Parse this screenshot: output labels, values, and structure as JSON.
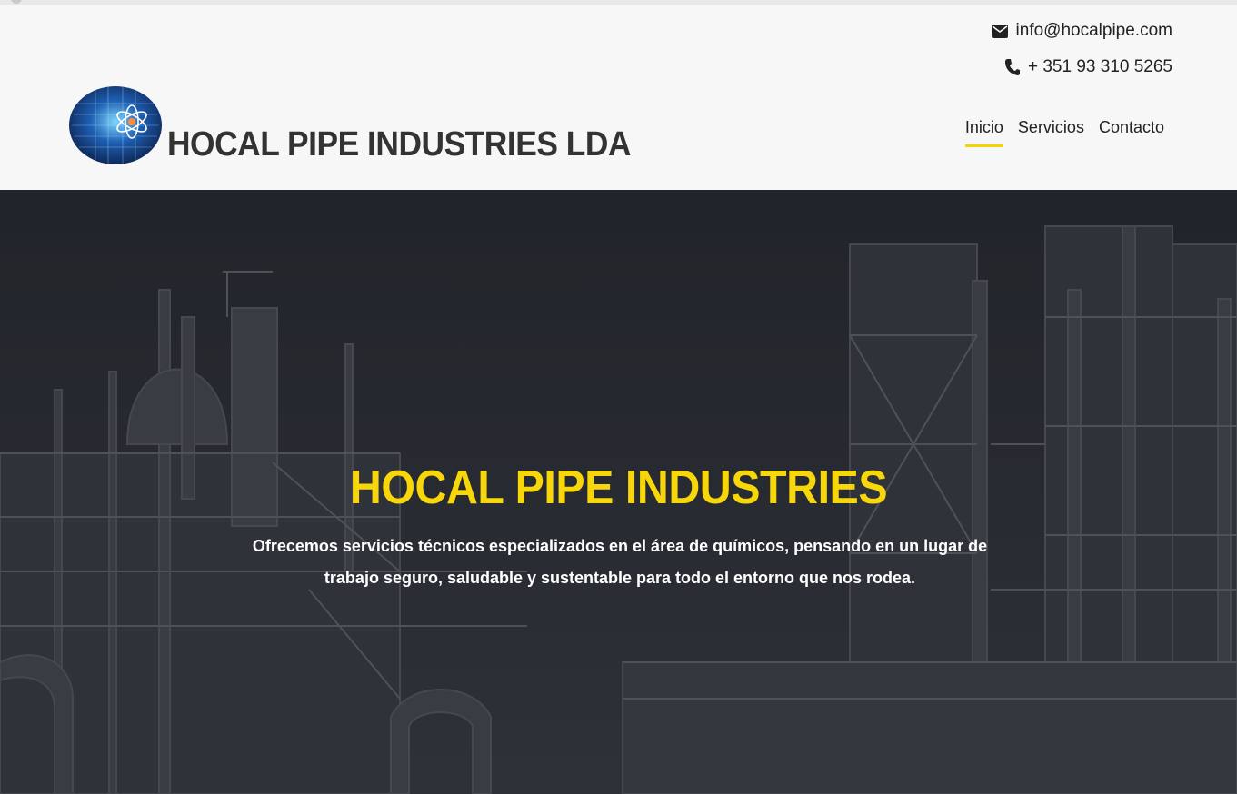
{
  "header": {
    "email": "info@hocalpipe.com",
    "phone": "+ 351 93 310 5265",
    "brand": "HOCAL PIPE INDUSTRIES LDA",
    "nav": [
      {
        "label": "Inicio",
        "active": true
      },
      {
        "label": "Servicios",
        "active": false
      },
      {
        "label": "Contacto",
        "active": false
      }
    ]
  },
  "hero": {
    "title": "HOCAL PIPE INDUSTRIES",
    "text": "Ofrecemos servicios técnicos especializados en el área de químicos, pensando en un lugar de trabajo seguro, saludable y sustentable para todo el entorno que nos rodea."
  },
  "colors": {
    "accent": "#f5d400",
    "hero_title": "#f7d70a",
    "header_bg": "#f7f7f7",
    "hero_overlay": "#2c2f36"
  },
  "icons": {
    "email": "envelope-icon",
    "phone": "phone-icon",
    "logo": "atom-logo-icon"
  }
}
